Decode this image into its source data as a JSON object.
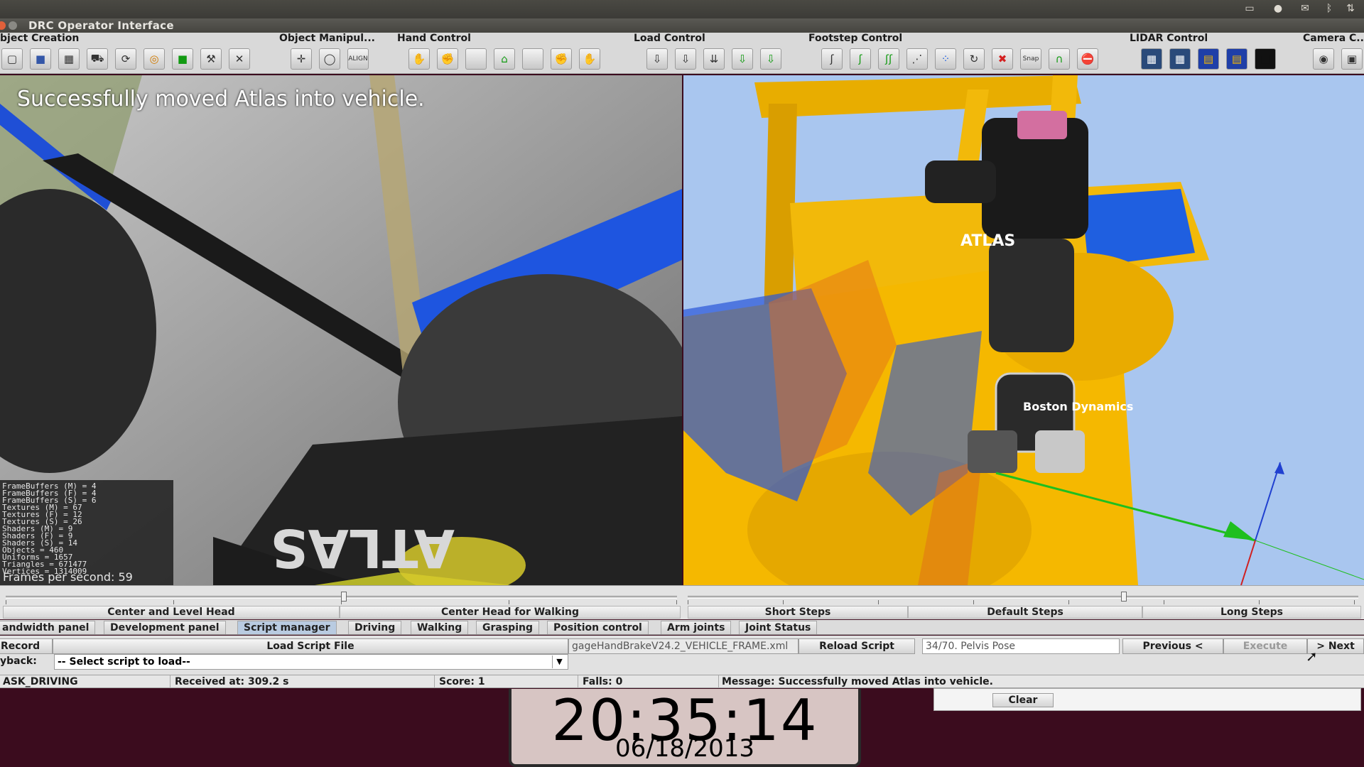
{
  "window": {
    "title": "DRC Operator Interface"
  },
  "toolbar": {
    "groups": [
      {
        "title": "bject Creation",
        "icons": [
          "box-icon",
          "cube-icon",
          "grid-icon",
          "car-icon",
          "update-icon",
          "ring-icon",
          "green-box-icon",
          "tool-icon",
          "cross-tool-icon"
        ]
      },
      {
        "title": "Object Manipul...",
        "icons": [
          "move-icon",
          "rotate-icon",
          "align-icon"
        ]
      },
      {
        "title": "Hand Control",
        "icons": [
          "hand-place-icon",
          "hand-close-icon",
          "hand-blank-icon",
          "hand-home-icon",
          "hand-blank2-icon",
          "hand-close2-icon",
          "hand-place2-icon"
        ]
      },
      {
        "title": "Load Control",
        "icons": [
          "load-icon",
          "load2-icon",
          "load-both-icon",
          "load-green-icon",
          "load-green2-icon"
        ]
      },
      {
        "title": "Footstep Control",
        "icons": [
          "foot-left-icon",
          "foot-green-icon",
          "foot-both-icon",
          "foot-path-icon",
          "foot-grid-icon",
          "foot-turn-icon",
          "foot-cancel-icon",
          "snap-icon",
          "foot-arc-icon",
          "foot-red-icon"
        ]
      },
      {
        "title": "LIDAR Control",
        "icons": [
          "lidar-enable-icon",
          "lidar-clear-icon",
          "lidar-scan-icon",
          "lidar-clear2-icon",
          "lidar-black-icon"
        ]
      },
      {
        "title": "Camera C...",
        "icons": [
          "eye-icon",
          "camera-icon"
        ]
      }
    ]
  },
  "camera": {
    "overlay_message": "Successfully moved Atlas into vehicle.",
    "stats": [
      "FrameBuffers (M) = 4",
      "FrameBuffers (F) = 4",
      "FrameBuffers (S) = 6",
      "Textures (M) = 67",
      "Textures (F) = 12",
      "Textures (S) = 26",
      "Shaders (M) = 9",
      "Shaders (F) = 9",
      "Shaders (S) = 14",
      "Objects = 460",
      "Uniforms = 1657",
      "Triangles = 671477",
      "Vertices = 1314009"
    ],
    "fps_label": "Frames per second: 59",
    "vehicle_text": "ATLAS"
  },
  "presets": {
    "head_left": "Center and Level Head",
    "head_right": "Center Head for Walking",
    "steps": [
      "Short Steps",
      "Default Steps",
      "Long Steps"
    ]
  },
  "tabs": [
    "andwidth panel",
    "Development panel",
    "Script manager",
    "Driving",
    "Walking",
    "Grasping",
    "Position control",
    "Arm joints",
    "Joint Status"
  ],
  "script": {
    "record_label": "Record",
    "load_label": "Load Script File",
    "file_name": "gageHandBrakeV24.2_VEHICLE_FRAME.xml",
    "reload_label": "Reload Script",
    "step_value": "34/70. Pelvis Pose",
    "previous_label": "Previous <",
    "execute_label": "Execute",
    "next_label": "> Next",
    "playback_label": "yback:",
    "playback_select": "-- Select script to load--"
  },
  "status": {
    "task": "ASK_DRIVING",
    "received": "Received at:  309.2 s",
    "score": "Score:  1",
    "falls": "Falls:  0",
    "message": "Message:  Successfully moved Atlas into vehicle."
  },
  "clear_label": "Clear",
  "clock": {
    "time": "20:35:14",
    "date": "06/18/2013"
  },
  "scene": {
    "robot_label": "Boston Dynamics",
    "chest_label": "ATLAS"
  },
  "colors": {
    "sky": "#a9c6ef",
    "vehicle": "#f5b800",
    "accent_blue": "#1f5fe0",
    "axis_green": "#1fbf1f"
  }
}
